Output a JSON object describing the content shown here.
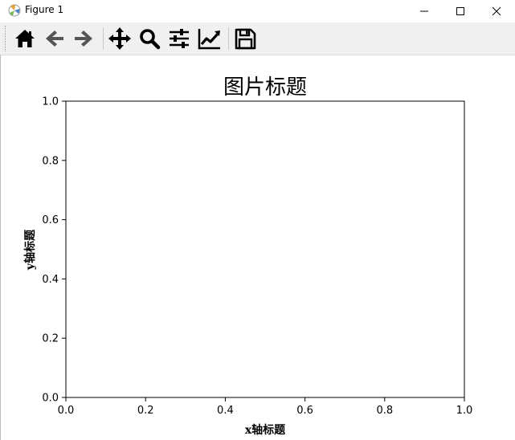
{
  "window": {
    "title": "Figure 1"
  },
  "toolbar": {
    "buttons": [
      {
        "name": "home",
        "icon": "home-icon"
      },
      {
        "name": "back",
        "icon": "arrow-left-icon"
      },
      {
        "name": "forward",
        "icon": "arrow-right-icon"
      },
      {
        "name": "pan",
        "icon": "move-icon"
      },
      {
        "name": "zoom",
        "icon": "magnifier-icon"
      },
      {
        "name": "configure-subplots",
        "icon": "sliders-icon"
      },
      {
        "name": "edit-axis",
        "icon": "line-chart-icon"
      },
      {
        "name": "save",
        "icon": "floppy-disk-icon"
      }
    ]
  },
  "chart_data": {
    "type": "line",
    "title": "图片标题",
    "xlabel": "x轴标题",
    "ylabel": "y轴标题",
    "xlim": [
      0.0,
      1.0
    ],
    "ylim": [
      0.0,
      1.0
    ],
    "xticks": [
      "0.0",
      "0.2",
      "0.4",
      "0.6",
      "0.8",
      "1.0"
    ],
    "yticks": [
      "0.0",
      "0.2",
      "0.4",
      "0.6",
      "0.8",
      "1.0"
    ],
    "series": [],
    "grid": false
  }
}
